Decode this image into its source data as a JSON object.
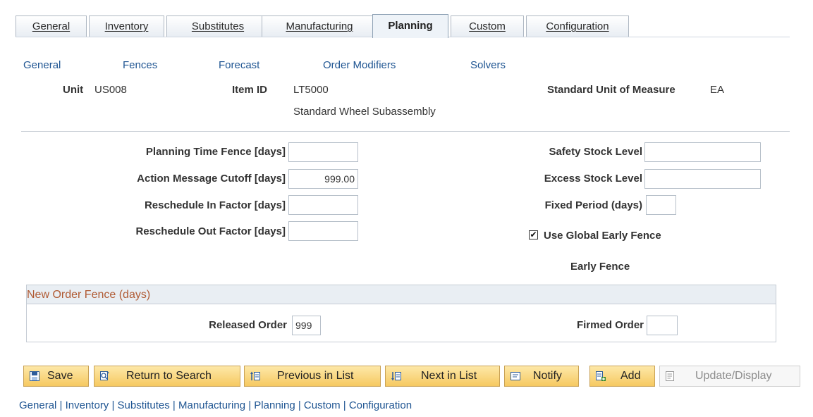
{
  "tabs": [
    {
      "label": "General",
      "active": false
    },
    {
      "label": "Inventory",
      "active": false
    },
    {
      "label": "Substitutes",
      "active": false
    },
    {
      "label": "Manufacturing",
      "active": false
    },
    {
      "label": "Planning",
      "active": true
    },
    {
      "label": "Custom",
      "active": false
    },
    {
      "label": "Configuration",
      "active": false
    }
  ],
  "subnav": [
    "General",
    "Fences",
    "Forecast",
    "Order Modifiers",
    "Solvers"
  ],
  "header": {
    "unit_label": "Unit",
    "unit_value": "US008",
    "item_label": "Item ID",
    "item_value": "LT5000",
    "item_desc": "Standard Wheel Subassembly",
    "uom_label": "Standard Unit of Measure",
    "uom_value": "EA"
  },
  "fields": {
    "planning_time_fence": {
      "label": "Planning Time Fence [days]",
      "value": ""
    },
    "action_message_cutoff": {
      "label": "Action Message Cutoff [days]",
      "value": "999.00"
    },
    "reschedule_in": {
      "label": "Reschedule In Factor [days]",
      "value": ""
    },
    "reschedule_out": {
      "label": "Reschedule Out Factor [days]",
      "value": ""
    },
    "safety_stock": {
      "label": "Safety Stock Level",
      "value": ""
    },
    "excess_stock": {
      "label": "Excess Stock Level",
      "value": ""
    },
    "fixed_period": {
      "label": "Fixed Period (days)",
      "value": ""
    }
  },
  "use_global_early_fence": {
    "label": "Use Global Early Fence",
    "checked": true,
    "mark": "✔"
  },
  "early_fence_label": "Early Fence",
  "new_order_fence": {
    "title": "New Order Fence (days)",
    "released_label": "Released Order",
    "released_value": "999",
    "firmed_label": "Firmed Order",
    "firmed_value": ""
  },
  "toolbar": {
    "save": "Save",
    "return_to_search": "Return to Search",
    "previous_in_list": "Previous in List",
    "next_in_list": "Next in List",
    "notify": "Notify",
    "add": "Add",
    "update_display": "Update/Display"
  },
  "footer_nav": [
    "General",
    "Inventory",
    "Substitutes",
    "Manufacturing",
    "Planning",
    "Custom",
    "Configuration"
  ],
  "footer_separator": " | ",
  "colors": {
    "link": "#1f5592",
    "group_title": "#b05a33",
    "button": "#f6c961"
  }
}
